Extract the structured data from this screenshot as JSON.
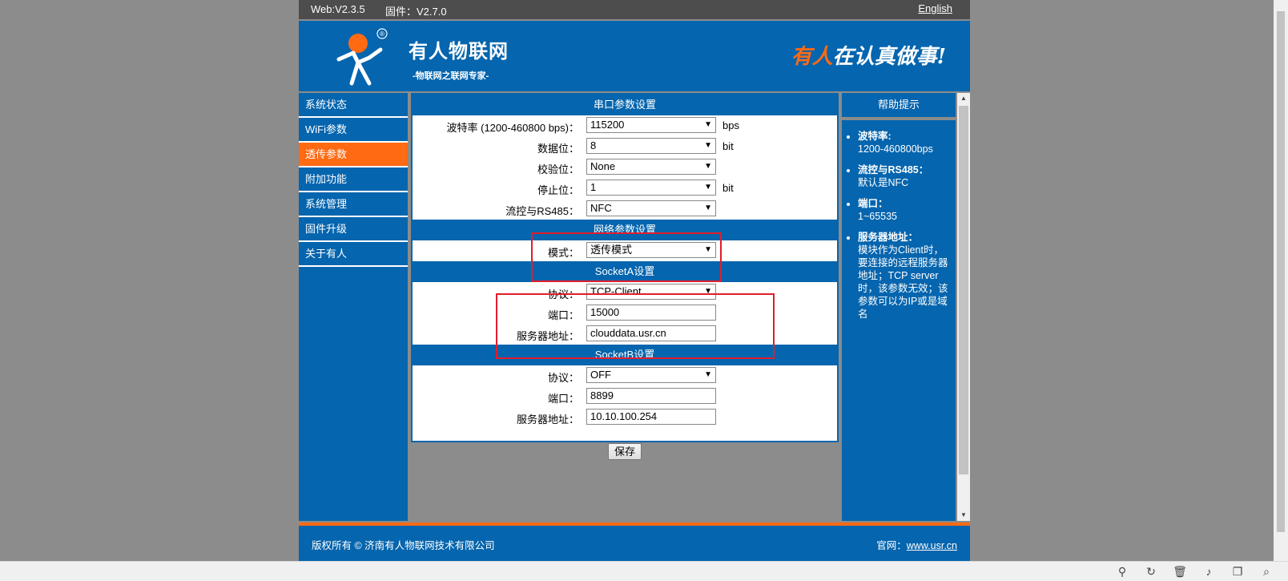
{
  "topbar": {
    "web_version": "Web:V2.3.5",
    "firmware": "固件：V2.7.0",
    "language_link": "English"
  },
  "header": {
    "brand": "有人物联网",
    "brand_sub": "-物联网之联网专家-",
    "slogan_highlight": "有人",
    "slogan_rest": "在认真做事!",
    "registered_mark": "®"
  },
  "nav": {
    "items": [
      {
        "label": "系统状态"
      },
      {
        "label": "WiFi参数"
      },
      {
        "label": "透传参数"
      },
      {
        "label": "附加功能"
      },
      {
        "label": "系统管理"
      },
      {
        "label": "固件升级"
      },
      {
        "label": "关于有人"
      }
    ],
    "active_index": 2
  },
  "serial": {
    "title": "串口参数设置",
    "baud": {
      "label": "波特率 (1200-460800 bps)：",
      "value": "115200",
      "unit": "bps"
    },
    "databits": {
      "label": "数据位：",
      "value": "8",
      "unit": "bit"
    },
    "parity": {
      "label": "校验位：",
      "value": "None"
    },
    "stopbits": {
      "label": "停止位：",
      "value": "1",
      "unit": "bit"
    },
    "flow": {
      "label": "流控与RS485：",
      "value": "NFC"
    }
  },
  "network": {
    "title": "网络参数设置",
    "mode": {
      "label": "模式：",
      "value": "透传模式"
    }
  },
  "socketA": {
    "title": "SocketA设置",
    "protocol": {
      "label": "协议：",
      "value": "TCP-Client"
    },
    "port": {
      "label": "端口：",
      "value": "15000"
    },
    "server": {
      "label": "服务器地址：",
      "value": "clouddata.usr.cn"
    }
  },
  "socketB": {
    "title": "SocketB设置",
    "protocol": {
      "label": "协议：",
      "value": "OFF"
    },
    "port": {
      "label": "端口：",
      "value": "8899"
    },
    "server": {
      "label": "服务器地址：",
      "value": "10.10.100.254"
    }
  },
  "save_label": "保存",
  "help": {
    "title": "帮助提示",
    "items": [
      {
        "term": "波特率:",
        "desc": "1200-460800bps"
      },
      {
        "term": "流控与RS485：",
        "desc": "默认是NFC"
      },
      {
        "term": "端口：",
        "desc": "1~65535"
      },
      {
        "term": "服务器地址：",
        "desc": "模块作为Client时，要连接的远程服务器地址；TCP server时，该参数无效；该参数可以为IP或是域名"
      }
    ]
  },
  "footer": {
    "copyright": "版权所有 © 济南有人物联网技术有限公司",
    "site_label": "官网：",
    "site_url": "www.usr.cn"
  },
  "colors": {
    "primary": "#0565ae",
    "accent": "#ff6a13",
    "highlight_box": "#e21d2b"
  }
}
